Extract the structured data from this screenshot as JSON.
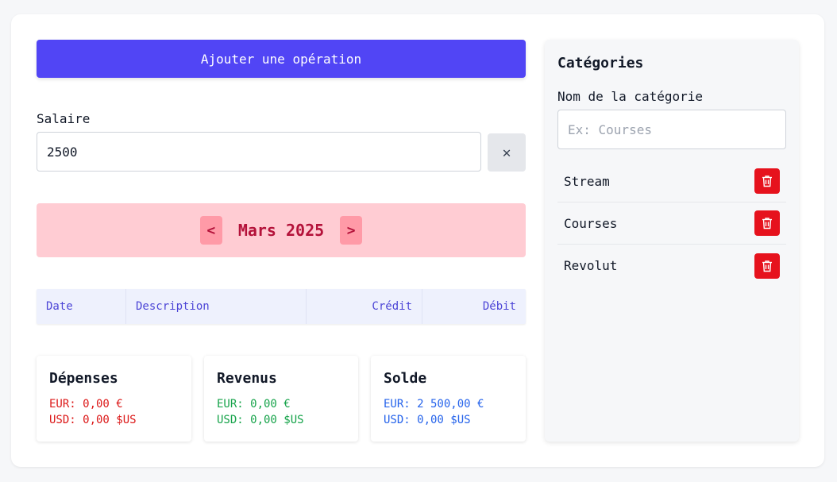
{
  "add_operation_label": "Ajouter une opération",
  "salary": {
    "label": "Salaire",
    "value": "2500",
    "clear_icon": "close-icon"
  },
  "month": {
    "prev": "<",
    "label": "Mars 2025",
    "next": ">"
  },
  "table": {
    "headers": [
      "Date",
      "Description",
      "Crédit",
      "Débit"
    ]
  },
  "summaries": [
    {
      "title": "Dépenses",
      "eur": "EUR: 0,00 €",
      "usd": "USD: 0,00 $US",
      "color": "#dc1818"
    },
    {
      "title": "Revenus",
      "eur": "EUR: 0,00 €",
      "usd": "USD: 0,00 $US",
      "color": "#16a34a"
    },
    {
      "title": "Solde",
      "eur": "EUR: 2 500,00 €",
      "usd": "USD: 0,00 $US",
      "color": "#2563eb"
    }
  ],
  "categories": {
    "title": "Catégories",
    "name_label": "Nom de la catégorie",
    "placeholder": "Ex: Courses",
    "items": [
      {
        "label": "Stream",
        "icon": "trash-icon"
      },
      {
        "label": "Courses",
        "icon": "trash-icon"
      },
      {
        "label": "Revolut",
        "icon": "trash-icon"
      }
    ]
  },
  "colors": {
    "accent": "#5145f5",
    "month_bg": "#ffccd3",
    "delete": "#e6121d"
  }
}
